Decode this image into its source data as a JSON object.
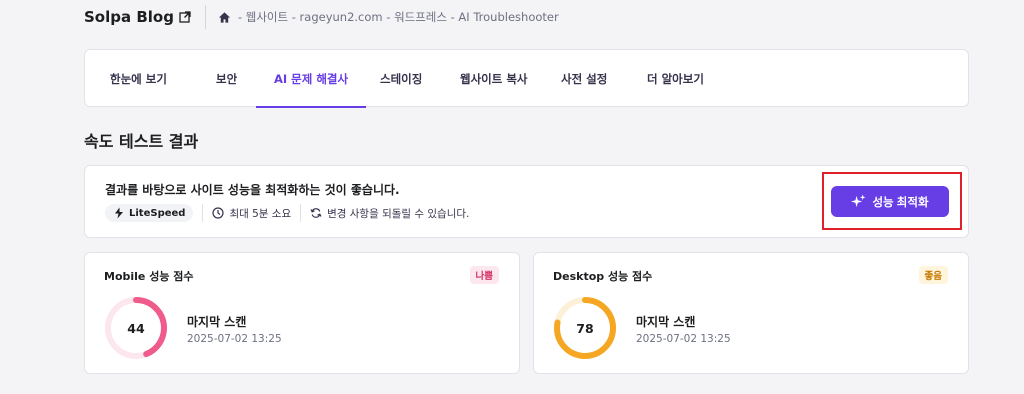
{
  "header": {
    "site_title": "Solpa Blog",
    "breadcrumb": "- 웹사이트 - rageyun2.com - 워드프레스 - AI Troubleshooter"
  },
  "tabs": [
    {
      "label": "한눈에 보기",
      "active": false
    },
    {
      "label": "보안",
      "active": false
    },
    {
      "label": "AI 문제 해결사",
      "active": true
    },
    {
      "label": "스테이징",
      "active": false
    },
    {
      "label": "웹사이트 복사",
      "active": false
    },
    {
      "label": "사전 설정",
      "active": false
    },
    {
      "label": "더 알아보기",
      "active": false
    }
  ],
  "section_title": "속도 테스트 결과",
  "optimize": {
    "title": "결과를 바탕으로 사이트 성능을 최적화하는 것이 좋습니다.",
    "badge": "LiteSpeed",
    "duration": "최대 5분 소요",
    "revert": "변경 사항을 되돌릴 수 있습니다.",
    "button_label": "성능 최적화"
  },
  "mobile": {
    "title": "Mobile 성능 점수",
    "badge": "나쁨",
    "score": "44",
    "score_fraction": 0.44,
    "color": "#ef5b8a",
    "track_color": "#fde7ee",
    "badge_bg": "#fde7ee",
    "badge_fg": "#d63163",
    "scan_title": "마지막 스캔",
    "scan_date": "2025-07-02 13:25"
  },
  "desktop": {
    "title": "Desktop 성능 점수",
    "badge": "좋음",
    "score": "78",
    "score_fraction": 0.78,
    "color": "#f5a623",
    "track_color": "#fdf0d9",
    "badge_bg": "#fff4dc",
    "badge_fg": "#c77a00",
    "scan_title": "마지막 스캔",
    "scan_date": "2025-07-02 13:25"
  },
  "colors": {
    "accent": "#673de6",
    "highlight": "#e0202a"
  }
}
